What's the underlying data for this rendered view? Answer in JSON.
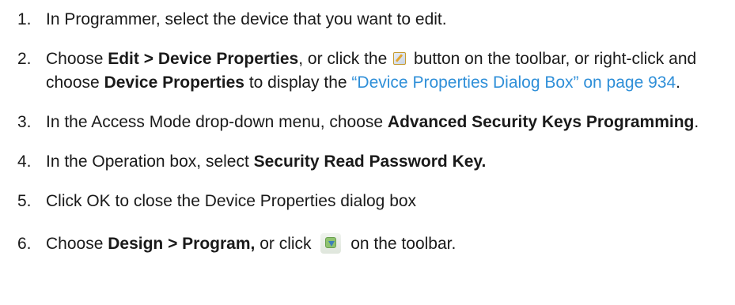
{
  "steps": [
    {
      "number": "1.",
      "text": "In Programmer, select the device that you want to edit."
    },
    {
      "number": "2.",
      "text_1": "Choose ",
      "bold_1": "Edit > Device Properties",
      "text_2": ", or click the ",
      "icon_name": "edit-device-properties-icon",
      "text_3": " button on the toolbar, or right-click and choose ",
      "bold_2": "Device Properties",
      "text_4": " to display the ",
      "link": "“Device Properties Dialog Box” on page 934",
      "text_5": "."
    },
    {
      "number": "3.",
      "text_1": "In the Access Mode drop-down menu, choose ",
      "bold_1": "Advanced Security Keys Programming",
      "text_2": "."
    },
    {
      "number": "4.",
      "text_1": "In the Operation box, select ",
      "bold_1": "Security Read Password Key."
    },
    {
      "number": "5.",
      "text": "Click OK to close the Device Properties dialog box"
    },
    {
      "number": "6.",
      "text_1": "Choose ",
      "bold_1": "Design > Program,",
      "text_2": " or click ",
      "icon_name": "program-device-icon",
      "text_3": " on the toolbar."
    }
  ],
  "colors": {
    "text": "#1a1a1a",
    "link": "#2f8fd8"
  }
}
